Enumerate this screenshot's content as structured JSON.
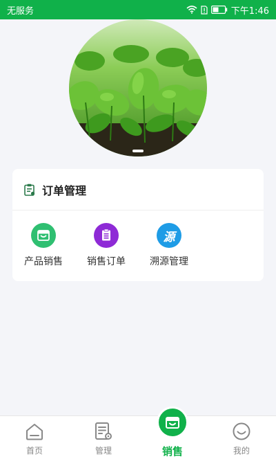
{
  "status_bar": {
    "carrier": "无服务",
    "time": "下午1:46"
  },
  "hero": {
    "image": "spinach-field-photo",
    "indicator_count": 1
  },
  "order_card": {
    "title": "订单管理",
    "icon": "clipboard-icon",
    "actions": [
      {
        "label": "产品销售",
        "icon": "shop-icon",
        "color": "#2fbf71"
      },
      {
        "label": "销售订单",
        "icon": "order-list-icon",
        "color": "#8e2ad6"
      },
      {
        "label": "溯源管理",
        "icon": "source-icon",
        "icon_text": "源",
        "color": "#1e9ce6"
      }
    ]
  },
  "tabbar": {
    "tabs": [
      {
        "label": "首页",
        "icon": "home-icon",
        "active": false
      },
      {
        "label": "管理",
        "icon": "manage-icon",
        "active": false
      },
      {
        "label": "销售",
        "icon": "sales-icon",
        "active": true
      },
      {
        "label": "我的",
        "icon": "profile-icon",
        "active": false
      }
    ]
  },
  "colors": {
    "brand": "#10b14a",
    "background": "#f4f5f9",
    "inactive": "#888888"
  }
}
